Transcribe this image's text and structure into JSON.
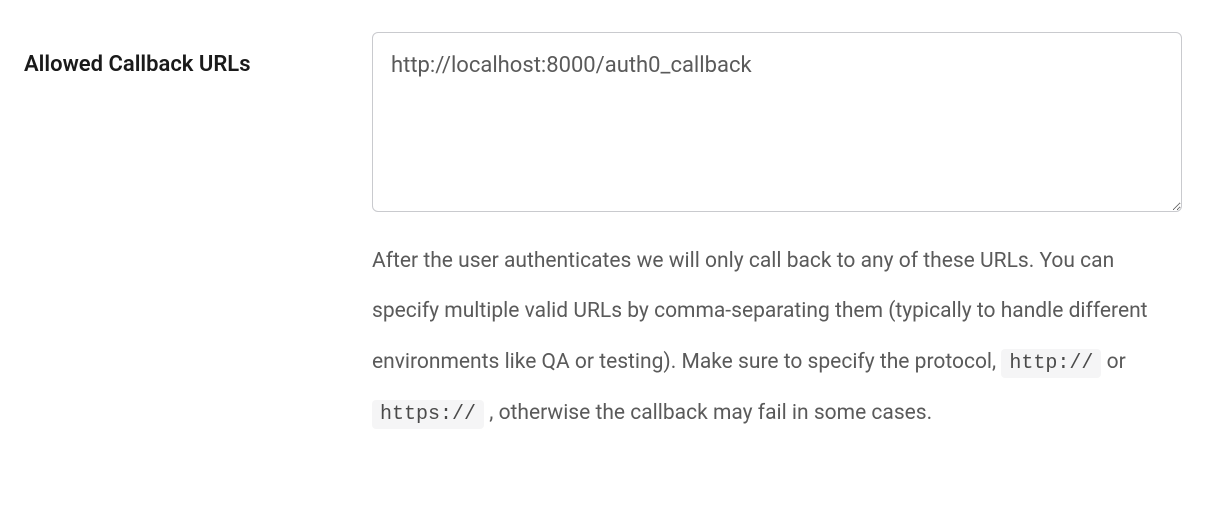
{
  "field": {
    "label": "Allowed Callback URLs",
    "value": "http://localhost:8000/auth0_callback",
    "help_prefix": "After the user authenticates we will only call back to any of these URLs. You can specify multiple valid URLs by comma-separating them (typically to handle different environments like QA or testing). Make sure to specify the protocol, ",
    "code_http": "http://",
    "help_mid": " or ",
    "code_https": "https://",
    "help_suffix": " , otherwise the callback may fail in some cases."
  }
}
